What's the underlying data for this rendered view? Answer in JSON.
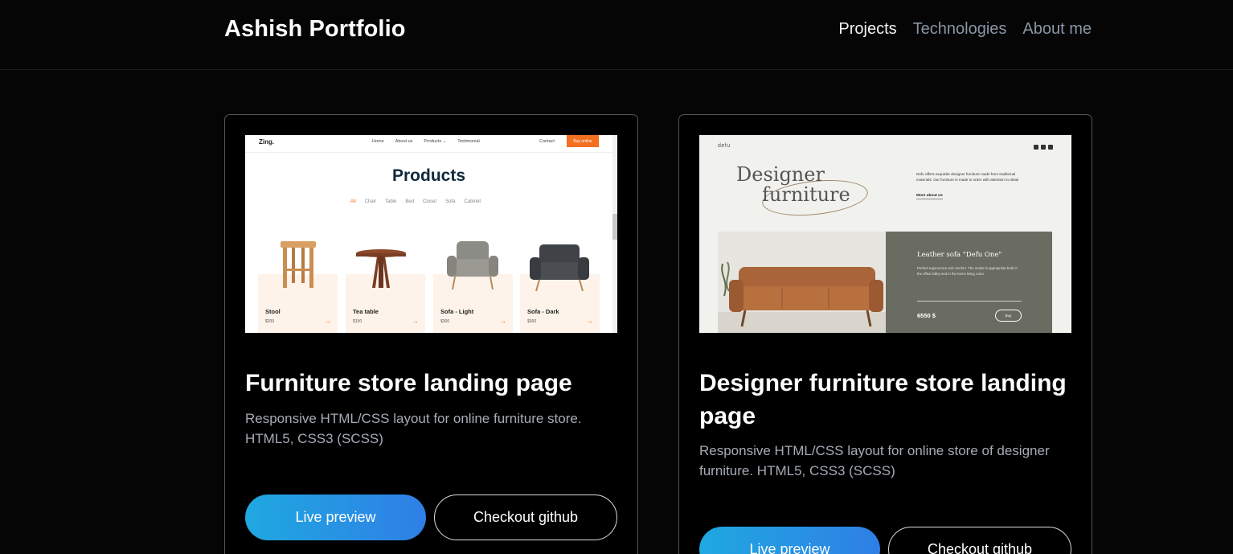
{
  "header": {
    "brand": "Ashish Portfolio",
    "nav": [
      "Projects",
      "Technologies",
      "About me"
    ],
    "active_nav": "Projects"
  },
  "colors": {
    "background": "#050505",
    "nav_inactive": "#8a96a6",
    "gradient_start": "#1fa8e0",
    "gradient_end": "#2f7fe6",
    "card_border": "#555555"
  },
  "projects": [
    {
      "title": "Furniture store landing page",
      "description": "Responsive HTML/CSS layout for online furniture store. HTML5, CSS3 (SCSS)",
      "live_label": "Live preview",
      "github_label": "Checkout github",
      "thumbnail": {
        "logo": "Zing.",
        "nav": [
          "Home",
          "About us",
          "Products ⌄",
          "Testimonial"
        ],
        "contact": "Contact",
        "buy": "Buy online",
        "heading": "Products",
        "filters": [
          "All",
          "Chair",
          "Table",
          "Bed",
          "Closet",
          "Sofa",
          "Cabinet"
        ],
        "products": [
          {
            "name": "Stool",
            "price": "$200"
          },
          {
            "name": "Tea table",
            "price": "$150"
          },
          {
            "name": "Sofa - Light",
            "price": "$300"
          },
          {
            "name": "Sofa - Dark",
            "price": "$300"
          }
        ],
        "arrow": "→"
      }
    },
    {
      "title": "Designer furniture store landing page",
      "description": "Responsive HTML/CSS layout for online store of designer furniture. HTML5, CSS3 (SCSS)",
      "live_label": "Live preview",
      "github_label": "Checkout github",
      "thumbnail": {
        "logo": "defu",
        "headline_1": "Designer",
        "headline_2": "furniture",
        "blurb": "Defu offers exquisite designer furniture made from traditional materials. Our furniture is made to order with attention to detail",
        "more": "More about us",
        "product_title": "Leather sofa \"Defu One\"",
        "product_desc": "Perfect ergonomics and comfort. The model is appropriate both in the office lobby and in the home living room",
        "price": "6550 $",
        "buy": "Buy"
      }
    }
  ]
}
